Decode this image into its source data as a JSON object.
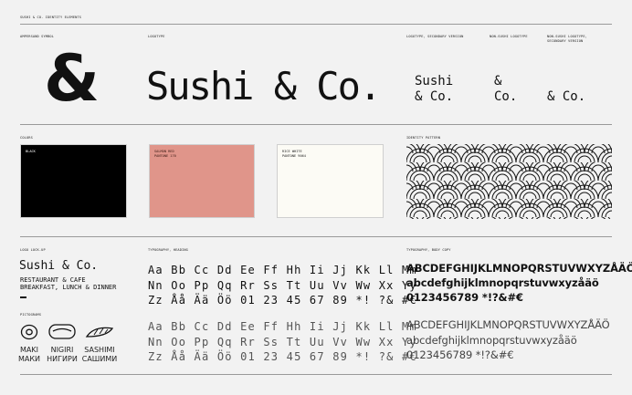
{
  "header": {
    "title": "SUSHI & CO. IDENTITY ELEMENTS"
  },
  "sections": {
    "ampersand": "AMPERSAND SYMBOL",
    "logotype": "LOGOTYPE",
    "logotype_secondary": "LOGOTYPE, SECONDARY VERSION",
    "non_sushi": "NON-SUSHI LOGOTYPE",
    "non_sushi_secondary": "NON-SUSHI LOGOTYPE,\nSECONDARY VERSION",
    "colors": "COLORS",
    "pattern": "IDENTITY PATTERN",
    "lockup": "LOGO LOCK-UP",
    "typography_heading": "TYPOGRAPHY, HEADING",
    "typography_body": "TYPOGRAPHY, BODY COPY",
    "pictograms": "PICTOGRAMS"
  },
  "logos": {
    "ampersand_symbol": "&",
    "main": "Sushi & Co.",
    "secondary_line1": "Sushi",
    "secondary_line2": "& Co.",
    "non_sushi_line1": "&",
    "non_sushi_line2": "Co.",
    "non_sushi_secondary": "& Co."
  },
  "colors": [
    {
      "name": "BLACK",
      "pantone": "",
      "hex": "#000000",
      "text_color": "#ffffff"
    },
    {
      "name": "SALMON RED",
      "pantone": "PANTONE 170",
      "hex": "#e0958a",
      "text_color": "#3a1a14"
    },
    {
      "name": "RICE WHITE",
      "pantone": "PANTONE 9064",
      "hex": "#fcfbf5",
      "text_color": "#222222"
    }
  ],
  "lockup": {
    "name": "Sushi & Co.",
    "line1": "RESTAURANT & CAFE",
    "line2": "BREAKFAST, LUNCH & DINNER"
  },
  "pictograms": [
    {
      "label_en": "MAKI",
      "label_ru": "МАКИ",
      "icon": "maki-icon"
    },
    {
      "label_en": "NIGIRI",
      "label_ru": "НИГИРИ",
      "icon": "nigiri-icon"
    },
    {
      "label_en": "SASHIMI",
      "label_ru": "САШИМИ",
      "icon": "sashimi-icon"
    }
  ],
  "heading_glyphs": [
    "Aa Bb Cc Dd Ee Ff Hh Ii Jj Kk Ll Mm",
    "Nn Oo Pp Qq Rr Ss Tt Uu Vv Ww Xx Yy",
    "Zz Åå Ää Öö 01 23 45 67 89 *! ?& #€"
  ],
  "heading_glyphs_light": [
    "Aa Bb Cc Dd Ee Ff Hh Ii Jj Kk Ll Mm",
    "Nn Oo Pp Qq Rr Ss Tt Uu Vv Ww Xx Yy",
    "Zz Åå Ää Öö 01 23 45 67 89 *! ?& #€"
  ],
  "body_glyphs_bold": [
    "ABCDEFGHIJKLMNOPQRSTUVWXYZÅÄÖ",
    "abcdefghijklmnopqrstuvwxyzåäö",
    "0123456789 *!?&#€"
  ],
  "body_glyphs_light": [
    "ABCDEFGHIJKLMNOPQRSTUVWXYZÅÄÖ",
    "abcdefghijklmnopqrstuvwxyzåäö",
    "0123456789 *!?&#€"
  ]
}
